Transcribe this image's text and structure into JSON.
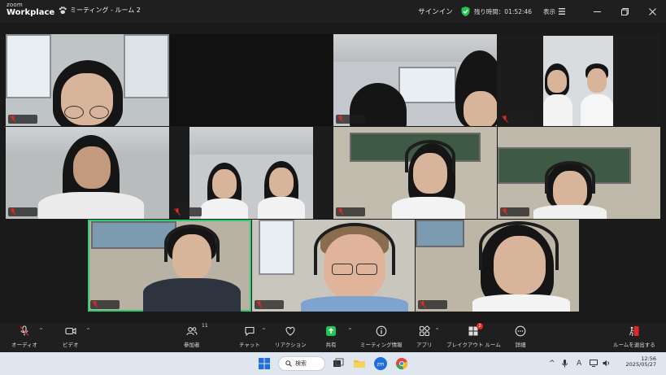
{
  "titlebar": {
    "brand_small": "zoom",
    "brand_main": "Workplace",
    "meeting_title": "ミーティング - ルーム 2",
    "signin": "サインイン",
    "remaining_time": "残り時間：01:52:46",
    "view_label": "表示",
    "window_controls": [
      "minimize",
      "maximize",
      "close"
    ]
  },
  "toolbar": {
    "audio_label": "オーディオ",
    "video_label": "ビデオ",
    "participants_label": "参加者",
    "participants_count": "11",
    "chat_label": "チャット",
    "reactions_label": "リアクション",
    "share_label": "共有",
    "meeting_info_label": "ミーティング情報",
    "apps_label": "アプリ",
    "breakout_label": "ブレイクアウト ルーム",
    "breakout_badge": "2",
    "more_label": "詳細",
    "leave_label": "ルームを退出する",
    "colors": {
      "share_green": "#23c552",
      "leave_red": "#e02828",
      "active_tile": "#2ecc71"
    }
  },
  "taskbar": {
    "search_label": "検索",
    "time": "12:56",
    "date": "2025/05/27",
    "ime_label": "A"
  }
}
